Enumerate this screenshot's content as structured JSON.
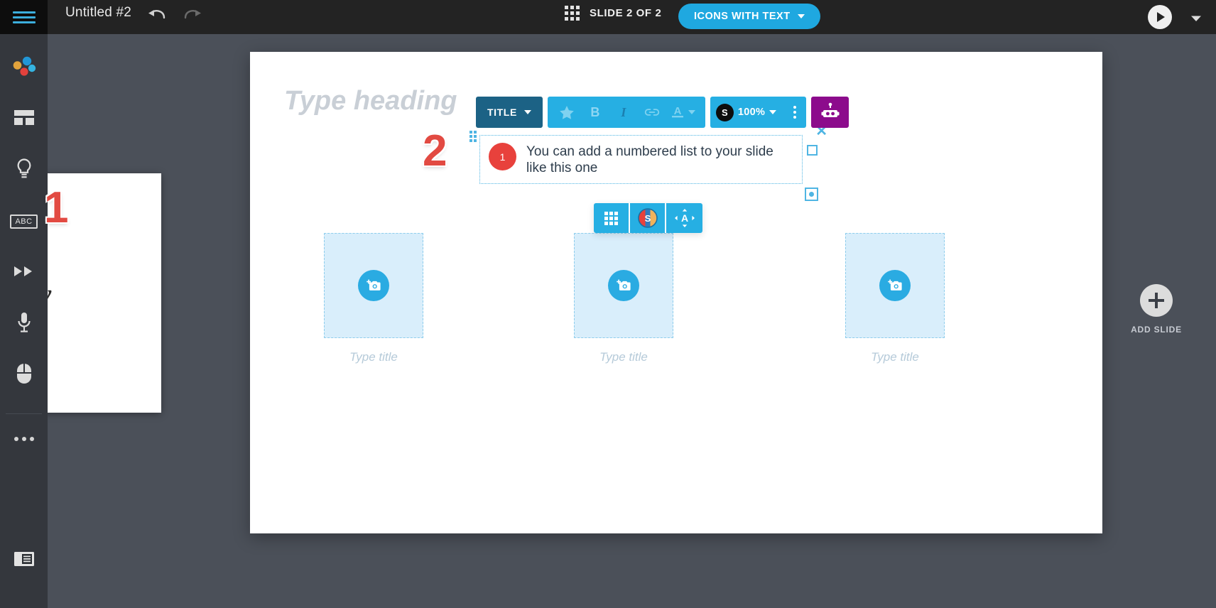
{
  "topbar": {
    "menu_icon": "hamburger-icon",
    "document_title": "Untitled #2",
    "undo_icon": "undo-icon",
    "redo_icon": "redo-icon",
    "grid_icon": "grid-menu-icon",
    "slide_counter": "SLIDE 2 OF 2",
    "layout_button": "ICONS WITH TEXT",
    "present_icon": "play-icon",
    "present_caret_icon": "chevron-down-icon"
  },
  "left_rail": {
    "items": [
      {
        "icon": "assets-dots-icon",
        "name": "assets"
      },
      {
        "icon": "layout-grid-icon",
        "name": "layout"
      },
      {
        "icon": "lightbulb-icon",
        "name": "ideas"
      },
      {
        "icon": "abc-text-icon",
        "label": "ABC",
        "name": "text"
      },
      {
        "icon": "fast-forward-icon",
        "name": "transition"
      },
      {
        "icon": "microphone-icon",
        "name": "audio"
      },
      {
        "icon": "mouse-icon",
        "name": "interaction"
      },
      {
        "icon": "ellipsis-icon",
        "name": "more"
      }
    ],
    "notes_icon": "notes-panel-icon"
  },
  "annotations": {
    "marker_one": "1",
    "marker_two": "2"
  },
  "slide_panel": {
    "glyph": "y"
  },
  "canvas": {
    "heading_placeholder": "Type heading"
  },
  "format_toolbar": {
    "style_dropdown": "TITLE",
    "caret_icon": "chevron-down-icon",
    "favorite_icon": "star-icon",
    "bold_label": "B",
    "italic_label": "I",
    "link_icon": "link-icon",
    "font_color_label": "A",
    "font_color_caret_icon": "chevron-down-icon",
    "shadow_badge": "S",
    "opacity_value": "100%",
    "opacity_caret_icon": "chevron-down-icon",
    "more_icon": "vertical-dots-icon",
    "assistant_icon": "robot-icon"
  },
  "textbox": {
    "bullet_number": "1",
    "body_text": "You can add a numbered list to your slide like this one",
    "close_icon": "close-icon",
    "resize_handle_icon": "resize-handle-icon",
    "rotate_handle_icon": "rotate-handle-icon"
  },
  "object_toolbar": {
    "buttons": [
      {
        "icon": "grid-layout-icon",
        "name": "arrange"
      },
      {
        "icon": "color-wheel-shadow-icon",
        "name": "style"
      },
      {
        "icon": "align-move-icon",
        "name": "align"
      }
    ]
  },
  "picture_slots": [
    {
      "add_icon": "add-photo-icon",
      "title_placeholder": "Type title"
    },
    {
      "add_icon": "add-photo-icon",
      "title_placeholder": "Type title"
    },
    {
      "add_icon": "add-photo-icon",
      "title_placeholder": "Type title"
    }
  ],
  "add_slide": {
    "plus_icon": "plus-icon",
    "label": "ADD SLIDE"
  },
  "colors": {
    "topbar_bg": "#232323",
    "rail_bg": "#34373d",
    "workspace_bg": "#4b5059",
    "accent_blue": "#26afe3",
    "deep_blue": "#1c6285",
    "purple": "#8c0b8c",
    "annotation_red": "#e24a42",
    "bullet_red": "#e8413c",
    "placeholder_blue": "#d9eefb"
  }
}
